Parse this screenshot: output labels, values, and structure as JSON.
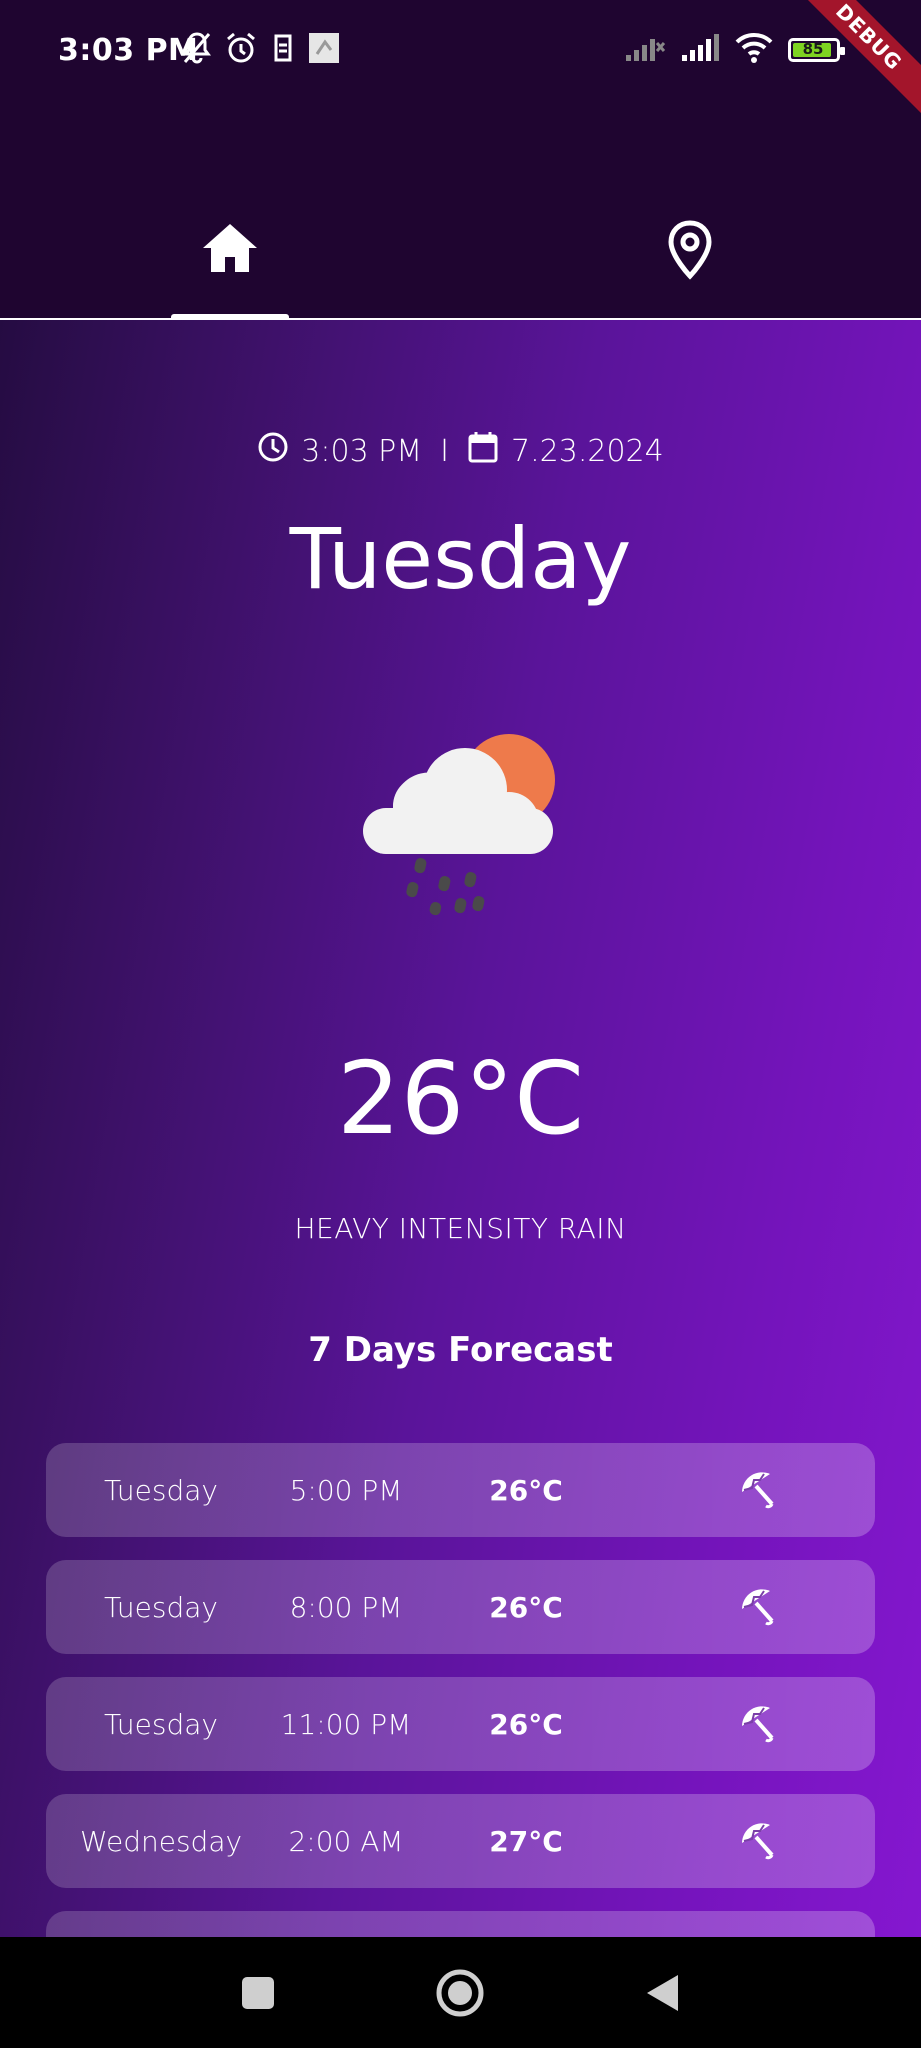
{
  "status_bar": {
    "time": "3:03 PM",
    "battery_level": "85",
    "icons": [
      "bell-off-icon",
      "alarm-icon",
      "sim-icon",
      "notification-icon",
      "signal-x-icon",
      "signal-icon",
      "wifi-icon",
      "battery-icon"
    ],
    "battery_color": "#7ed321"
  },
  "debug_banner": "DEBUG",
  "tabs": [
    {
      "id": "home",
      "icon": "home-icon",
      "selected": true
    },
    {
      "id": "location",
      "icon": "location-pin-icon",
      "selected": false
    }
  ],
  "weather": {
    "time": "3:03 PM",
    "separator": "I",
    "date": "7.23.2024",
    "day": "Tuesday",
    "icon": "rain-cloud-sun-icon",
    "temperature": "26°C",
    "description": "HEAVY INTENSITY RAIN"
  },
  "forecast": {
    "title": "7 Days Forecast",
    "items": [
      {
        "day": "Tuesday",
        "time": "5:00 PM",
        "temp": "26°C",
        "icon": "umbrella-icon"
      },
      {
        "day": "Tuesday",
        "time": "8:00 PM",
        "temp": "26°C",
        "icon": "umbrella-icon"
      },
      {
        "day": "Tuesday",
        "time": "11:00 PM",
        "temp": "26°C",
        "icon": "umbrella-icon"
      },
      {
        "day": "Wednesday",
        "time": "2:00 AM",
        "temp": "27°C",
        "icon": "umbrella-icon"
      }
    ]
  },
  "colors": {
    "appbar": "#1f0530",
    "gradient_start": "#250c42",
    "gradient_end": "#8517d0",
    "sun": "#ee7a4b"
  }
}
